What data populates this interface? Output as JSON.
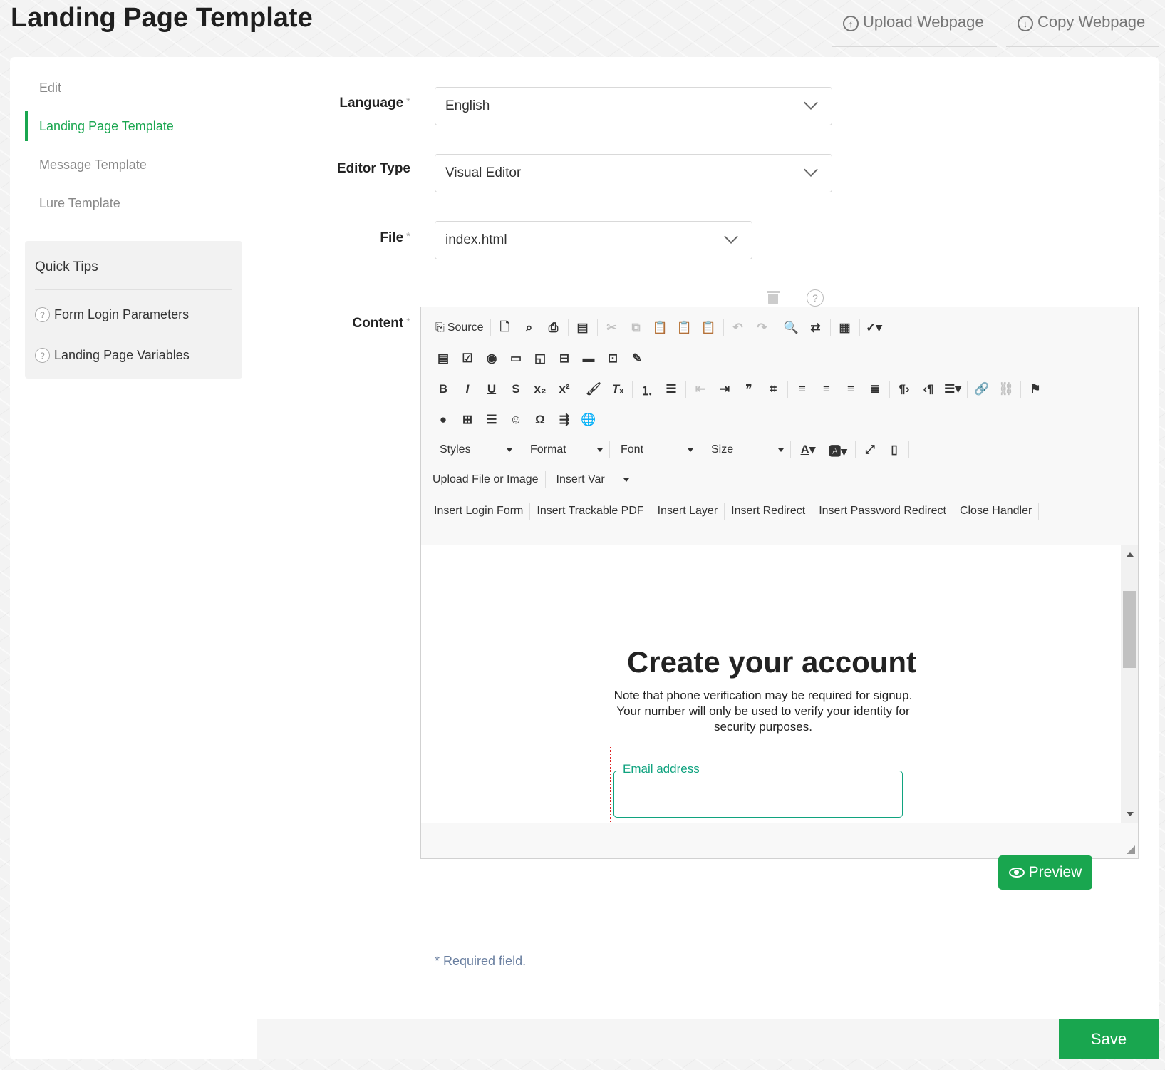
{
  "header": {
    "title": "Landing Page Template",
    "upload_label": "Upload Webpage",
    "copy_label": "Copy Webpage"
  },
  "sidebar": {
    "items": [
      {
        "label": "Edit"
      },
      {
        "label": "Landing Page Template",
        "active": true
      },
      {
        "label": "Message Template"
      },
      {
        "label": "Lure Template"
      }
    ],
    "tips_title": "Quick Tips",
    "tips": [
      {
        "label": "Form Login Parameters",
        "icon": "question-icon"
      },
      {
        "label": "Landing Page Variables",
        "icon": "question-icon"
      }
    ]
  },
  "form": {
    "language_label": "Language",
    "language_value": "English",
    "editor_type_label": "Editor Type",
    "editor_type_value": "Visual Editor",
    "file_label": "File",
    "file_value": "index.html",
    "content_label": "Content",
    "required_mark": "*",
    "help_glyph": "?"
  },
  "toolbar": {
    "source_label": "Source",
    "styles_label": "Styles",
    "format_label": "Format",
    "font_label": "Font",
    "size_label": "Size",
    "upload_label": "Upload File or Image",
    "insert_var_label": "Insert Var",
    "custom_buttons": [
      "Insert Login Form",
      "Insert Trackable PDF",
      "Insert Layer",
      "Insert Redirect",
      "Insert Password Redirect",
      "Close Handler"
    ]
  },
  "document": {
    "heading": "Create your account",
    "paragraph": "Note that phone verification may be required for signup. Your number will only be used to verify your identity for security purposes.",
    "email_legend": "Email address"
  },
  "footer": {
    "preview_label": "Preview",
    "required_note": "* Required field.",
    "save_label": "Save"
  },
  "colors": {
    "accent": "#19a64f",
    "field_accent": "#10a37f",
    "note": "#6a7fa0"
  }
}
